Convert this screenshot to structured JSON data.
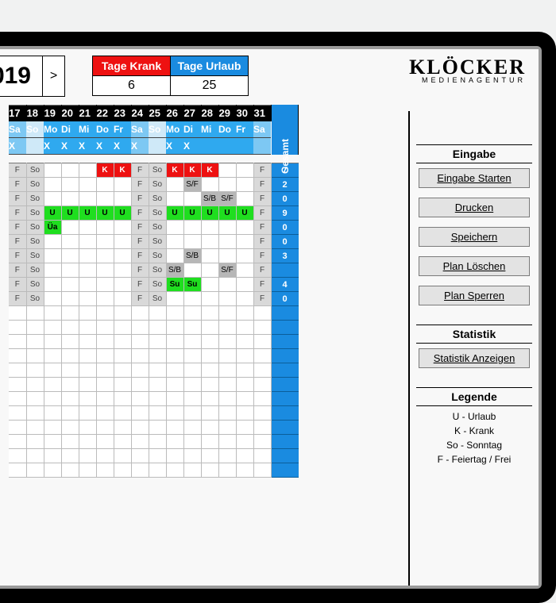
{
  "year": "019",
  "year_nav_next": ">",
  "stats": {
    "sick_label": "Tage Krank",
    "sick_value": "6",
    "vac_label": "Tage Urlaub",
    "vac_value": "25"
  },
  "logo": {
    "main": "KLÖCKER",
    "sub": "MEDIENAGENTUR"
  },
  "days": {
    "nums": [
      "17",
      "18",
      "19",
      "20",
      "21",
      "22",
      "23",
      "24",
      "25",
      "26",
      "27",
      "28",
      "29",
      "30",
      "31"
    ],
    "dows": [
      "Sa",
      "So",
      "Mo",
      "Di",
      "Mi",
      "Do",
      "Fr",
      "Sa",
      "So",
      "Mo",
      "Di",
      "Mi",
      "Do",
      "Fr",
      "Sa"
    ],
    "x": [
      "X",
      "",
      "X",
      "X",
      "X",
      "X",
      "X",
      "X",
      "",
      "X",
      "X",
      "",
      "",
      "",
      ""
    ]
  },
  "gesamt_label": "Gesamt",
  "rows": [
    {
      "cells": [
        {
          "t": "F",
          "c": "lgrey"
        },
        {
          "t": "So",
          "c": "lgrey"
        },
        {
          "t": ""
        },
        {
          "t": ""
        },
        {
          "t": ""
        },
        {
          "t": "K",
          "c": "red"
        },
        {
          "t": "K",
          "c": "red"
        },
        {
          "t": "F",
          "c": "lgrey"
        },
        {
          "t": "So",
          "c": "lgrey"
        },
        {
          "t": "K",
          "c": "red"
        },
        {
          "t": "K",
          "c": "red"
        },
        {
          "t": "K",
          "c": "red"
        },
        {
          "t": ""
        },
        {
          "t": ""
        },
        {
          "t": "F",
          "c": "lgrey"
        }
      ],
      "g": "7"
    },
    {
      "cells": [
        {
          "t": "F",
          "c": "lgrey"
        },
        {
          "t": "So",
          "c": "lgrey"
        },
        {
          "t": ""
        },
        {
          "t": ""
        },
        {
          "t": ""
        },
        {
          "t": ""
        },
        {
          "t": ""
        },
        {
          "t": "F",
          "c": "lgrey"
        },
        {
          "t": "So",
          "c": "lgrey"
        },
        {
          "t": ""
        },
        {
          "t": "S/F",
          "c": "grey"
        },
        {
          "t": ""
        },
        {
          "t": ""
        },
        {
          "t": ""
        },
        {
          "t": "F",
          "c": "lgrey"
        }
      ],
      "g": "2"
    },
    {
      "cells": [
        {
          "t": "F",
          "c": "lgrey"
        },
        {
          "t": "So",
          "c": "lgrey"
        },
        {
          "t": ""
        },
        {
          "t": ""
        },
        {
          "t": ""
        },
        {
          "t": ""
        },
        {
          "t": ""
        },
        {
          "t": "F",
          "c": "lgrey"
        },
        {
          "t": "So",
          "c": "lgrey"
        },
        {
          "t": ""
        },
        {
          "t": ""
        },
        {
          "t": "S/B",
          "c": "grey"
        },
        {
          "t": "S/F",
          "c": "grey"
        },
        {
          "t": ""
        },
        {
          "t": "F",
          "c": "lgrey"
        }
      ],
      "g": "0"
    },
    {
      "cells": [
        {
          "t": "F",
          "c": "lgrey"
        },
        {
          "t": "So",
          "c": "lgrey"
        },
        {
          "t": "U",
          "c": "green"
        },
        {
          "t": "U",
          "c": "green"
        },
        {
          "t": "U",
          "c": "green"
        },
        {
          "t": "U",
          "c": "green"
        },
        {
          "t": "U",
          "c": "green"
        },
        {
          "t": "F",
          "c": "lgrey"
        },
        {
          "t": "So",
          "c": "lgrey"
        },
        {
          "t": "U",
          "c": "green"
        },
        {
          "t": "U",
          "c": "green"
        },
        {
          "t": "U",
          "c": "green"
        },
        {
          "t": "U",
          "c": "green"
        },
        {
          "t": "U",
          "c": "green"
        },
        {
          "t": "F",
          "c": "lgrey"
        }
      ],
      "g": "9"
    },
    {
      "cells": [
        {
          "t": "F",
          "c": "lgrey"
        },
        {
          "t": "So",
          "c": "lgrey"
        },
        {
          "t": "Üa",
          "c": "green"
        },
        {
          "t": ""
        },
        {
          "t": ""
        },
        {
          "t": ""
        },
        {
          "t": ""
        },
        {
          "t": "F",
          "c": "lgrey"
        },
        {
          "t": "So",
          "c": "lgrey"
        },
        {
          "t": ""
        },
        {
          "t": ""
        },
        {
          "t": ""
        },
        {
          "t": ""
        },
        {
          "t": ""
        },
        {
          "t": "F",
          "c": "lgrey"
        }
      ],
      "g": "0"
    },
    {
      "cells": [
        {
          "t": "F",
          "c": "lgrey"
        },
        {
          "t": "So",
          "c": "lgrey"
        },
        {
          "t": ""
        },
        {
          "t": ""
        },
        {
          "t": ""
        },
        {
          "t": ""
        },
        {
          "t": ""
        },
        {
          "t": "F",
          "c": "lgrey"
        },
        {
          "t": "So",
          "c": "lgrey"
        },
        {
          "t": ""
        },
        {
          "t": ""
        },
        {
          "t": ""
        },
        {
          "t": ""
        },
        {
          "t": ""
        },
        {
          "t": "F",
          "c": "lgrey"
        }
      ],
      "g": "0"
    },
    {
      "cells": [
        {
          "t": "F",
          "c": "lgrey"
        },
        {
          "t": "So",
          "c": "lgrey"
        },
        {
          "t": ""
        },
        {
          "t": ""
        },
        {
          "t": ""
        },
        {
          "t": ""
        },
        {
          "t": ""
        },
        {
          "t": "F",
          "c": "lgrey"
        },
        {
          "t": "So",
          "c": "lgrey"
        },
        {
          "t": ""
        },
        {
          "t": "S/B",
          "c": "grey"
        },
        {
          "t": ""
        },
        {
          "t": ""
        },
        {
          "t": ""
        },
        {
          "t": "F",
          "c": "lgrey"
        }
      ],
      "g": "3"
    },
    {
      "cells": [
        {
          "t": "F",
          "c": "lgrey"
        },
        {
          "t": "So",
          "c": "lgrey"
        },
        {
          "t": ""
        },
        {
          "t": ""
        },
        {
          "t": ""
        },
        {
          "t": ""
        },
        {
          "t": ""
        },
        {
          "t": "F",
          "c": "lgrey"
        },
        {
          "t": "So",
          "c": "lgrey"
        },
        {
          "t": "S/B",
          "c": "grey"
        },
        {
          "t": ""
        },
        {
          "t": ""
        },
        {
          "t": "S/F",
          "c": "grey"
        },
        {
          "t": ""
        },
        {
          "t": "F",
          "c": "lgrey"
        }
      ],
      "g": ""
    },
    {
      "cells": [
        {
          "t": "F",
          "c": "lgrey"
        },
        {
          "t": "So",
          "c": "lgrey"
        },
        {
          "t": ""
        },
        {
          "t": ""
        },
        {
          "t": ""
        },
        {
          "t": ""
        },
        {
          "t": ""
        },
        {
          "t": "F",
          "c": "lgrey"
        },
        {
          "t": "So",
          "c": "lgrey"
        },
        {
          "t": "Su",
          "c": "green"
        },
        {
          "t": "Su",
          "c": "green"
        },
        {
          "t": ""
        },
        {
          "t": ""
        },
        {
          "t": ""
        },
        {
          "t": "F",
          "c": "lgrey"
        }
      ],
      "g": "4"
    },
    {
      "cells": [
        {
          "t": "F",
          "c": "lgrey"
        },
        {
          "t": "So",
          "c": "lgrey"
        },
        {
          "t": ""
        },
        {
          "t": ""
        },
        {
          "t": ""
        },
        {
          "t": ""
        },
        {
          "t": ""
        },
        {
          "t": "F",
          "c": "lgrey"
        },
        {
          "t": "So",
          "c": "lgrey"
        },
        {
          "t": ""
        },
        {
          "t": ""
        },
        {
          "t": ""
        },
        {
          "t": ""
        },
        {
          "t": ""
        },
        {
          "t": "F",
          "c": "lgrey"
        }
      ],
      "g": "0"
    },
    {
      "cells": [
        {
          "t": ""
        },
        {
          "t": ""
        },
        {
          "t": ""
        },
        {
          "t": ""
        },
        {
          "t": ""
        },
        {
          "t": ""
        },
        {
          "t": ""
        },
        {
          "t": ""
        },
        {
          "t": ""
        },
        {
          "t": ""
        },
        {
          "t": ""
        },
        {
          "t": ""
        },
        {
          "t": ""
        },
        {
          "t": ""
        },
        {
          "t": ""
        }
      ],
      "g": ""
    },
    {
      "cells": [
        {
          "t": ""
        },
        {
          "t": ""
        },
        {
          "t": ""
        },
        {
          "t": ""
        },
        {
          "t": ""
        },
        {
          "t": ""
        },
        {
          "t": ""
        },
        {
          "t": ""
        },
        {
          "t": ""
        },
        {
          "t": ""
        },
        {
          "t": ""
        },
        {
          "t": ""
        },
        {
          "t": ""
        },
        {
          "t": ""
        },
        {
          "t": ""
        }
      ],
      "g": ""
    },
    {
      "cells": [
        {
          "t": ""
        },
        {
          "t": ""
        },
        {
          "t": ""
        },
        {
          "t": ""
        },
        {
          "t": ""
        },
        {
          "t": ""
        },
        {
          "t": ""
        },
        {
          "t": ""
        },
        {
          "t": ""
        },
        {
          "t": ""
        },
        {
          "t": ""
        },
        {
          "t": ""
        },
        {
          "t": ""
        },
        {
          "t": ""
        },
        {
          "t": ""
        }
      ],
      "g": ""
    },
    {
      "cells": [
        {
          "t": ""
        },
        {
          "t": ""
        },
        {
          "t": ""
        },
        {
          "t": ""
        },
        {
          "t": ""
        },
        {
          "t": ""
        },
        {
          "t": ""
        },
        {
          "t": ""
        },
        {
          "t": ""
        },
        {
          "t": ""
        },
        {
          "t": ""
        },
        {
          "t": ""
        },
        {
          "t": ""
        },
        {
          "t": ""
        },
        {
          "t": ""
        }
      ],
      "g": ""
    },
    {
      "cells": [
        {
          "t": ""
        },
        {
          "t": ""
        },
        {
          "t": ""
        },
        {
          "t": ""
        },
        {
          "t": ""
        },
        {
          "t": ""
        },
        {
          "t": ""
        },
        {
          "t": ""
        },
        {
          "t": ""
        },
        {
          "t": ""
        },
        {
          "t": ""
        },
        {
          "t": ""
        },
        {
          "t": ""
        },
        {
          "t": ""
        },
        {
          "t": ""
        }
      ],
      "g": ""
    },
    {
      "cells": [
        {
          "t": ""
        },
        {
          "t": ""
        },
        {
          "t": ""
        },
        {
          "t": ""
        },
        {
          "t": ""
        },
        {
          "t": ""
        },
        {
          "t": ""
        },
        {
          "t": ""
        },
        {
          "t": ""
        },
        {
          "t": ""
        },
        {
          "t": ""
        },
        {
          "t": ""
        },
        {
          "t": ""
        },
        {
          "t": ""
        },
        {
          "t": ""
        }
      ],
      "g": ""
    },
    {
      "cells": [
        {
          "t": ""
        },
        {
          "t": ""
        },
        {
          "t": ""
        },
        {
          "t": ""
        },
        {
          "t": ""
        },
        {
          "t": ""
        },
        {
          "t": ""
        },
        {
          "t": ""
        },
        {
          "t": ""
        },
        {
          "t": ""
        },
        {
          "t": ""
        },
        {
          "t": ""
        },
        {
          "t": ""
        },
        {
          "t": ""
        },
        {
          "t": ""
        }
      ],
      "g": ""
    },
    {
      "cells": [
        {
          "t": ""
        },
        {
          "t": ""
        },
        {
          "t": ""
        },
        {
          "t": ""
        },
        {
          "t": ""
        },
        {
          "t": ""
        },
        {
          "t": ""
        },
        {
          "t": ""
        },
        {
          "t": ""
        },
        {
          "t": ""
        },
        {
          "t": ""
        },
        {
          "t": ""
        },
        {
          "t": ""
        },
        {
          "t": ""
        },
        {
          "t": ""
        }
      ],
      "g": ""
    },
    {
      "cells": [
        {
          "t": ""
        },
        {
          "t": ""
        },
        {
          "t": ""
        },
        {
          "t": ""
        },
        {
          "t": ""
        },
        {
          "t": ""
        },
        {
          "t": ""
        },
        {
          "t": ""
        },
        {
          "t": ""
        },
        {
          "t": ""
        },
        {
          "t": ""
        },
        {
          "t": ""
        },
        {
          "t": ""
        },
        {
          "t": ""
        },
        {
          "t": ""
        }
      ],
      "g": ""
    },
    {
      "cells": [
        {
          "t": ""
        },
        {
          "t": ""
        },
        {
          "t": ""
        },
        {
          "t": ""
        },
        {
          "t": ""
        },
        {
          "t": ""
        },
        {
          "t": ""
        },
        {
          "t": ""
        },
        {
          "t": ""
        },
        {
          "t": ""
        },
        {
          "t": ""
        },
        {
          "t": ""
        },
        {
          "t": ""
        },
        {
          "t": ""
        },
        {
          "t": ""
        }
      ],
      "g": ""
    },
    {
      "cells": [
        {
          "t": ""
        },
        {
          "t": ""
        },
        {
          "t": ""
        },
        {
          "t": ""
        },
        {
          "t": ""
        },
        {
          "t": ""
        },
        {
          "t": ""
        },
        {
          "t": ""
        },
        {
          "t": ""
        },
        {
          "t": ""
        },
        {
          "t": ""
        },
        {
          "t": ""
        },
        {
          "t": ""
        },
        {
          "t": ""
        },
        {
          "t": ""
        }
      ],
      "g": ""
    },
    {
      "cells": [
        {
          "t": ""
        },
        {
          "t": ""
        },
        {
          "t": ""
        },
        {
          "t": ""
        },
        {
          "t": ""
        },
        {
          "t": ""
        },
        {
          "t": ""
        },
        {
          "t": ""
        },
        {
          "t": ""
        },
        {
          "t": ""
        },
        {
          "t": ""
        },
        {
          "t": ""
        },
        {
          "t": ""
        },
        {
          "t": ""
        },
        {
          "t": ""
        }
      ],
      "g": ""
    }
  ],
  "sidebar": {
    "eingabe_title": "Eingabe",
    "btn_start": "Eingabe Starten",
    "btn_print": "Drucken",
    "btn_save": "Speichern",
    "btn_delete": "Plan Löschen",
    "btn_lock": "Plan Sperren",
    "stat_title": "Statistik",
    "btn_stat": "Statistik Anzeigen",
    "legend_title": "Legende",
    "legend_u": "U - Urlaub",
    "legend_k": "K - Krank",
    "legend_so": "So - Sonntag",
    "legend_f": "F - Feiertag / Frei"
  }
}
